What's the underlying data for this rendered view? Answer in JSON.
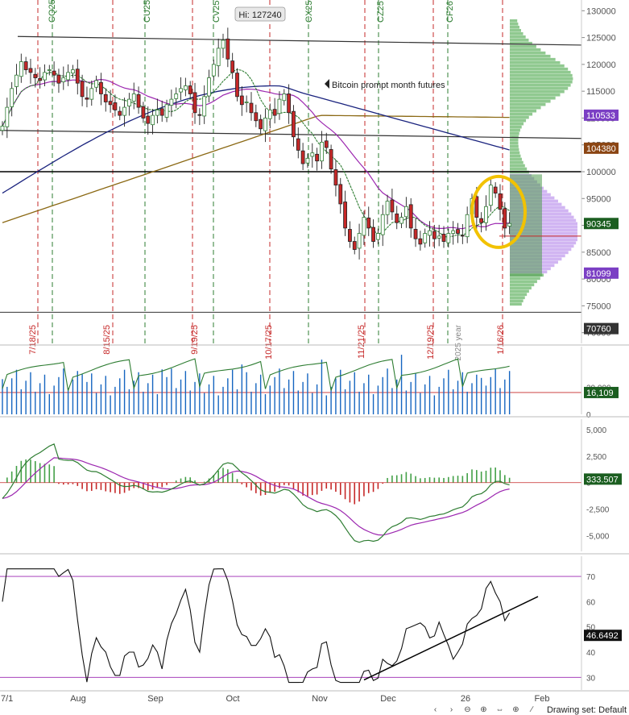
{
  "chart_data": {
    "type": "candlestick",
    "instrument_label": "Bitcoin prompt month futures",
    "hi_label": "Hi: 127240",
    "price_panel": {
      "ylim": [
        68000,
        132000
      ],
      "ticks": [
        "130000",
        "125000",
        "120000",
        "115000",
        "110000",
        "105000",
        "100000",
        "95000",
        "90000",
        "85000",
        "80000",
        "75000",
        "70000"
      ],
      "tick_values": [
        130000,
        125000,
        120000,
        115000,
        110000,
        105000,
        100000,
        95000,
        90000,
        85000,
        80000,
        75000,
        70000
      ],
      "badges": [
        {
          "label": "110533",
          "value": 110533,
          "color": "#7b3fc4"
        },
        {
          "label": "104380",
          "value": 104380,
          "color": "#8b4513"
        },
        {
          "label": "90345",
          "value": 90345,
          "color": "#1b5e20"
        },
        {
          "label": "81099",
          "value": 81099,
          "color": "#7b3fc4"
        },
        {
          "label": "70760",
          "value": 70760,
          "color": "#333333"
        }
      ],
      "horizontal_lines": [
        {
          "value": 100000,
          "color": "#000000"
        },
        {
          "value": 73800,
          "color": "#333333"
        },
        {
          "value": 88000,
          "color": "#c62828"
        }
      ],
      "expiry_labels": [
        "CQ25",
        "CU25",
        "CV25",
        "CX25",
        "CZ25",
        "CF26"
      ],
      "date_markers": [
        "7/18/25",
        "8/15/25",
        "9/19/25",
        "10/17/25",
        "11/21/25",
        "12/19/25",
        "1/16/26"
      ],
      "year_marker": "2025 year",
      "closes": [
        108500,
        112000,
        115500,
        118000,
        120500,
        119000,
        118500,
        117500,
        117000,
        118500,
        119000,
        118000,
        116500,
        117500,
        118500,
        119000,
        116500,
        114000,
        113500,
        115500,
        117000,
        114500,
        113000,
        112500,
        111500,
        110500,
        112000,
        113500,
        114500,
        112000,
        110000,
        109000,
        110500,
        111500,
        110500,
        112500,
        113500,
        114500,
        115500,
        116000,
        114500,
        111000,
        110500,
        114000,
        117500,
        120000,
        123000,
        124500,
        121000,
        118500,
        114000,
        112500,
        113000,
        111000,
        109500,
        108000,
        110000,
        111500,
        110500,
        113500,
        114500,
        111000,
        106500,
        104000,
        101500,
        102500,
        103500,
        102000,
        105500,
        104500,
        100500,
        97500,
        94000,
        89500,
        87000,
        85500,
        88500,
        91500,
        89500,
        87000,
        88500,
        92000,
        94500,
        92500,
        90500,
        91500,
        93500,
        89500,
        87500,
        86500,
        88500,
        89000,
        87500,
        88000,
        87000,
        88500,
        89000,
        88500,
        88000,
        92000,
        95000,
        91500,
        90500,
        93500,
        97500,
        96000,
        93000,
        89500,
        90345
      ],
      "ma_short": {
        "color": "#2e7d32",
        "closes_offset": "8-period"
      },
      "ma_purple": {
        "color": "#9c27b0"
      },
      "ma_blue": {
        "color": "#1a237e"
      },
      "ma_brown": {
        "color": "#8b6914"
      }
    },
    "volume_panel": {
      "ylim": [
        0,
        50000
      ],
      "ticks": [
        "20,000",
        "0"
      ],
      "tick_values": [
        20000,
        0
      ],
      "badge": {
        "label": "16,109",
        "value": 16109,
        "color": "#1b5e20"
      }
    },
    "macd_panel": {
      "ylim": [
        -6500,
        6000
      ],
      "ticks": [
        "5,000",
        "2,500",
        "0",
        "-2,500",
        "-5,000"
      ],
      "tick_values": [
        5000,
        2500,
        0,
        -2500,
        -5000
      ],
      "badge": {
        "label": "333.507",
        "value": 333.507,
        "color": "#1b5e20"
      }
    },
    "rsi_panel": {
      "ylim": [
        25,
        78
      ],
      "ticks": [
        "70",
        "60",
        "50",
        "40",
        "30"
      ],
      "tick_values": [
        70,
        60,
        50,
        40,
        30
      ],
      "badge": {
        "label": "46.6492",
        "value": 46.6492,
        "color": "#111111"
      },
      "trendline": {
        "color": "#000000"
      }
    },
    "x_axis": {
      "labels": [
        "7/1",
        "Aug",
        "Sep",
        "Oct",
        "Nov",
        "Dec",
        "26",
        "Feb"
      ]
    }
  },
  "toolbar": {
    "drawing_set_label": "Drawing set: Default",
    "icons": [
      "scroll-left-icon",
      "scroll-right-icon",
      "reset-icon",
      "zoom-in-icon",
      "zoom-out-icon",
      "crosshair-icon",
      "draw-line-icon"
    ]
  }
}
